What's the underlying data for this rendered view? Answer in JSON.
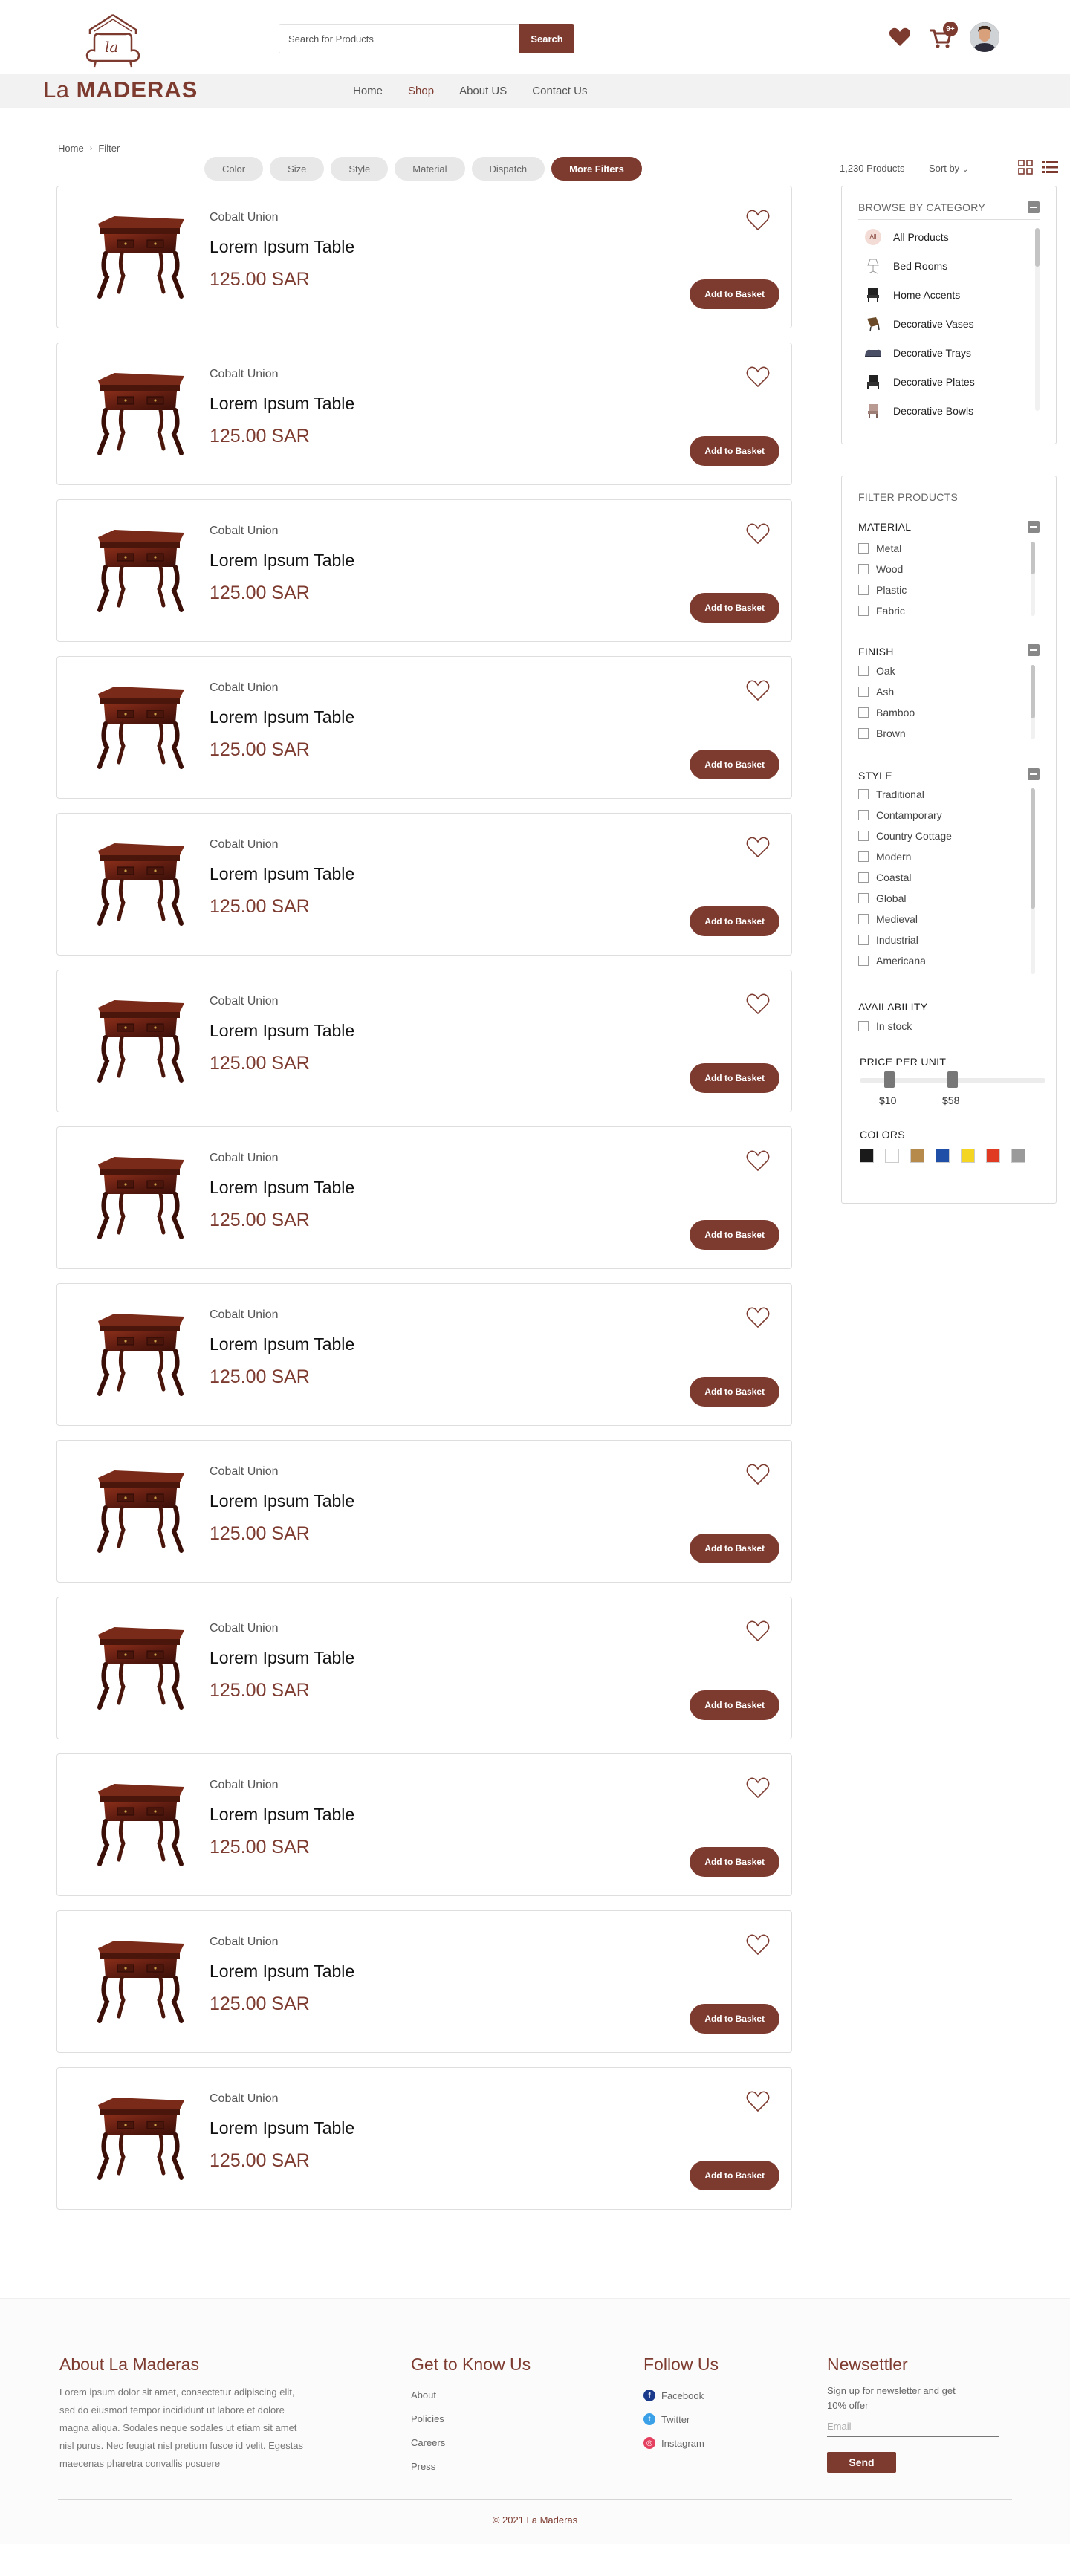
{
  "header": {
    "search": {
      "placeholder": "Search for Products",
      "button_label": "Search"
    },
    "cart_badge": "9+",
    "brand": {
      "prefix": "La",
      "name": "MADERAS"
    },
    "nav": [
      {
        "label": "Home"
      },
      {
        "label": "Shop"
      },
      {
        "label": "About US"
      },
      {
        "label": "Contact Us"
      }
    ]
  },
  "breadcrumb": [
    "Home",
    "Filter"
  ],
  "filter_chips": [
    "Color",
    "Size",
    "Style",
    "Material",
    "Dispatch",
    "More Filters"
  ],
  "results": {
    "count": "1,230 Products",
    "sort_label": "Sort by"
  },
  "products": [
    {
      "brand": "Cobalt Union",
      "name": "Lorem Ipsum Table",
      "price": "125.00 SAR",
      "button": "Add to Basket"
    },
    {
      "brand": "Cobalt Union",
      "name": "Lorem Ipsum Table",
      "price": "125.00 SAR",
      "button": "Add to Basket"
    },
    {
      "brand": "Cobalt Union",
      "name": "Lorem Ipsum Table",
      "price": "125.00 SAR",
      "button": "Add to Basket"
    },
    {
      "brand": "Cobalt Union",
      "name": "Lorem Ipsum Table",
      "price": "125.00 SAR",
      "button": "Add to Basket"
    },
    {
      "brand": "Cobalt Union",
      "name": "Lorem Ipsum Table",
      "price": "125.00 SAR",
      "button": "Add to Basket"
    },
    {
      "brand": "Cobalt Union",
      "name": "Lorem Ipsum Table",
      "price": "125.00 SAR",
      "button": "Add to Basket"
    },
    {
      "brand": "Cobalt Union",
      "name": "Lorem Ipsum Table",
      "price": "125.00 SAR",
      "button": "Add to Basket"
    },
    {
      "brand": "Cobalt Union",
      "name": "Lorem Ipsum Table",
      "price": "125.00 SAR",
      "button": "Add to Basket"
    },
    {
      "brand": "Cobalt Union",
      "name": "Lorem Ipsum Table",
      "price": "125.00 SAR",
      "button": "Add to Basket"
    },
    {
      "brand": "Cobalt Union",
      "name": "Lorem Ipsum Table",
      "price": "125.00 SAR",
      "button": "Add to Basket"
    },
    {
      "brand": "Cobalt Union",
      "name": "Lorem Ipsum Table",
      "price": "125.00 SAR",
      "button": "Add to Basket"
    },
    {
      "brand": "Cobalt Union",
      "name": "Lorem Ipsum Table",
      "price": "125.00 SAR",
      "button": "Add to Basket"
    },
    {
      "brand": "Cobalt Union",
      "name": "Lorem Ipsum Table",
      "price": "125.00 SAR",
      "button": "Add to Basket"
    }
  ],
  "categories": {
    "title": "BROWSE BY CATEGORY",
    "all_icon_text": "All",
    "items": [
      {
        "label": "All Products",
        "icon": "all-icon"
      },
      {
        "label": "Bed Rooms",
        "icon": "lamp-icon"
      },
      {
        "label": "Home Accents",
        "icon": "chair-icon"
      },
      {
        "label": "Decorative Vases",
        "icon": "vase-icon"
      },
      {
        "label": "Decorative Trays",
        "icon": "tray-icon"
      },
      {
        "label": "Decorative Plates",
        "icon": "armchair-icon"
      },
      {
        "label": "Decorative Bowls",
        "icon": "stool-icon"
      }
    ]
  },
  "filters": {
    "title": "FILTER PRODUCTS",
    "groups": [
      {
        "title": "MATERIAL",
        "options": [
          "Metal",
          "Wood",
          "Plastic",
          "Fabric"
        ]
      },
      {
        "title": "FINISH",
        "options": [
          "Oak",
          "Ash",
          "Bamboo",
          "Brown"
        ]
      },
      {
        "title": "STYLE",
        "options": [
          "Traditional",
          "Contamporary",
          "Country Cottage",
          "Modern",
          "Coastal",
          "Global",
          "Medieval",
          "Industrial",
          "Americana"
        ]
      },
      {
        "title": "AVAILABILITY",
        "options": [
          "In stock"
        ]
      }
    ],
    "price": {
      "title": "PRICE PER UNIT",
      "min_label": "$10",
      "max_label": "$58",
      "range_fraction": [
        0.16,
        0.5
      ]
    },
    "colors_title": "COLORS",
    "colors": [
      "#1a1a1a",
      "#ffffff",
      "#b58a4a",
      "#1f4fa6",
      "#f4d522",
      "#e03a22",
      "#9a9a9a"
    ]
  },
  "footer": {
    "about": {
      "title": "About La Maderas",
      "text": "Lorem ipsum dolor sit amet, consectetur adipiscing elit, sed do eiusmod tempor incididunt ut labore et dolore magna aliqua. Sodales neque sodales ut etiam sit amet nisl purus. Nec feugiat nisl pretium fusce id velit. Egestas maecenas pharetra convallis posuere"
    },
    "know": {
      "title": "Get to Know Us",
      "links": [
        "About",
        "Policies",
        "Careers",
        "Press"
      ]
    },
    "follow": {
      "title": "Follow Us",
      "links": [
        {
          "label": "Facebook",
          "icon": "facebook-icon",
          "glyph": "f",
          "color": "#1b3a8c"
        },
        {
          "label": "Twitter",
          "icon": "twitter-icon",
          "glyph": "t",
          "color": "#3aa1e8"
        },
        {
          "label": "Instagram",
          "icon": "instagram-icon",
          "glyph": "◎",
          "color": "#e4405f"
        }
      ]
    },
    "newsletter": {
      "title": "Newsettler",
      "text": "Sign up for newsletter and get 10% offer",
      "placeholder": "Email",
      "button": "Send"
    },
    "copyright": "© 2021 La Maderas"
  },
  "theme": {
    "accent": "#7d3b30"
  }
}
